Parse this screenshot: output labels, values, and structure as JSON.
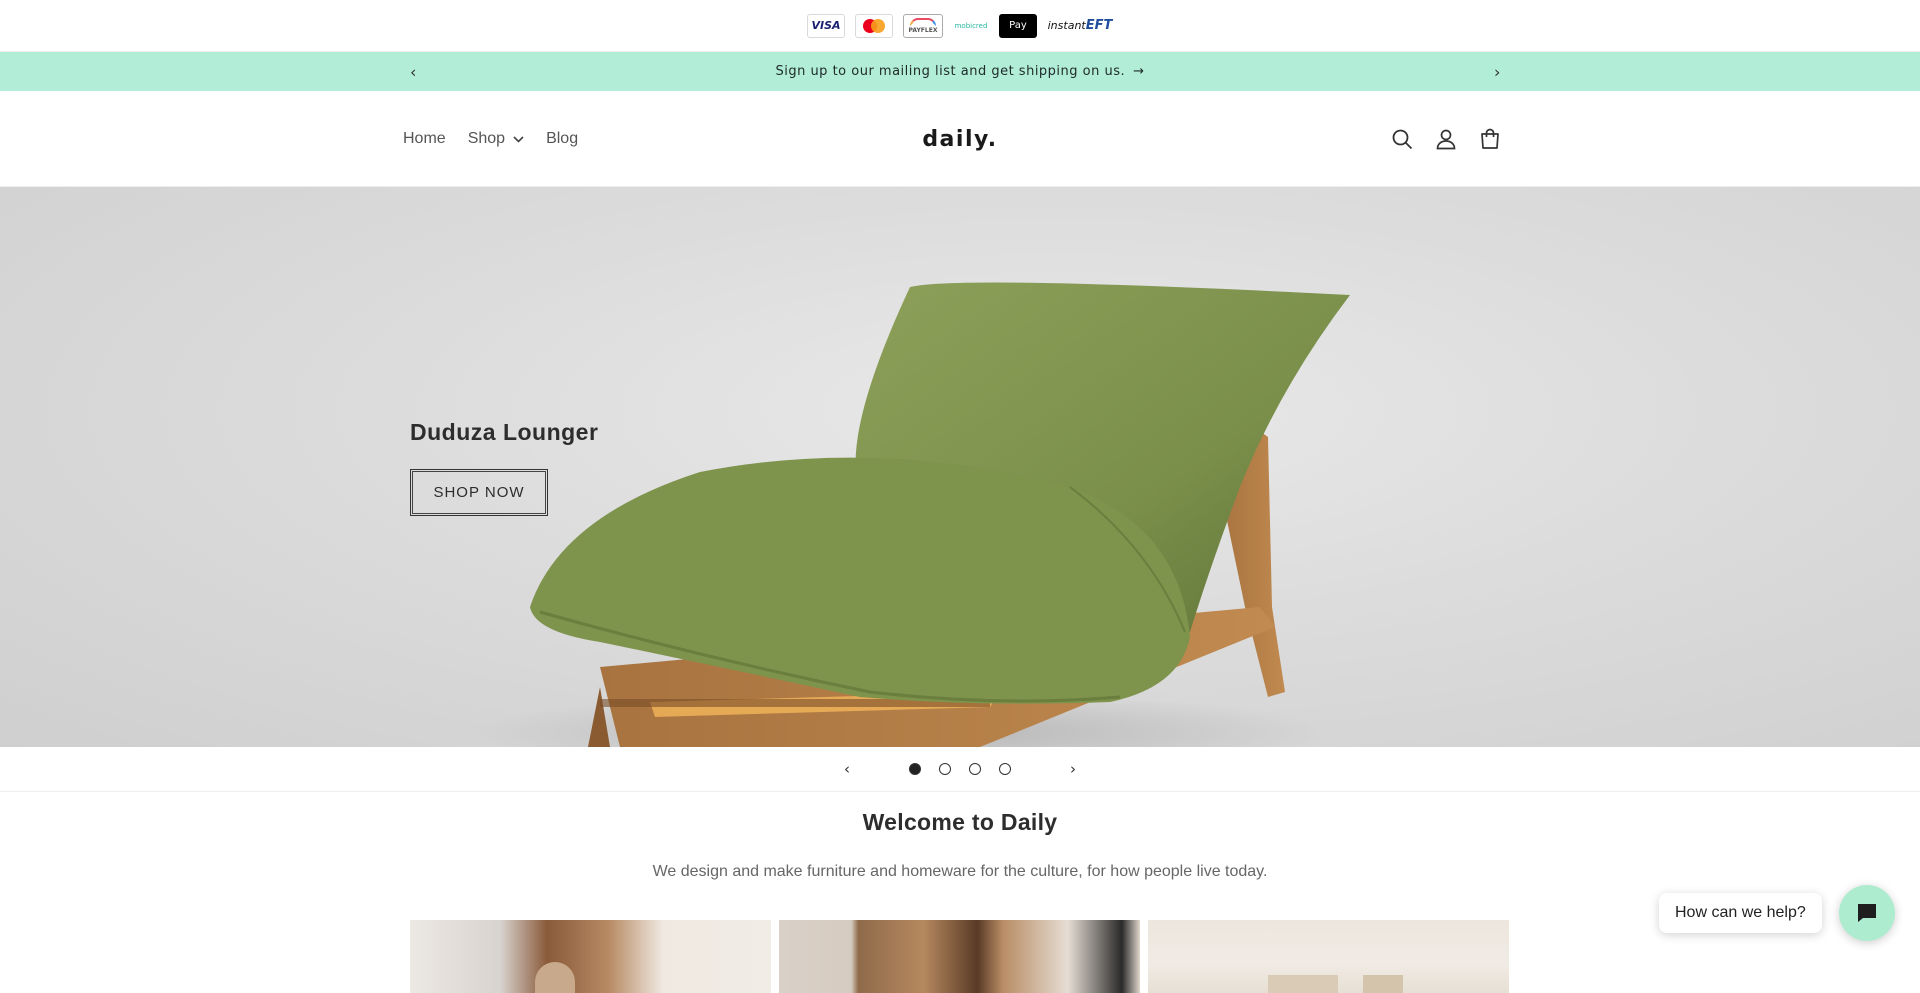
{
  "payment_methods": [
    {
      "name": "Visa",
      "label": "VISA"
    },
    {
      "name": "Mastercard",
      "label": ""
    },
    {
      "name": "Payflex",
      "label": "PAYFLEX"
    },
    {
      "name": "Mobicred",
      "label": "mobicred"
    },
    {
      "name": "Apple Pay",
      "label": "Pay"
    },
    {
      "name": "Instant EFT",
      "label": "instant",
      "label_bold": "EFT"
    }
  ],
  "announcement": {
    "text": "Sign up to our mailing list and get shipping on us.",
    "prev_icon": "chevron-left-icon",
    "next_icon": "chevron-right-icon",
    "arrow_icon": "arrow-right-icon"
  },
  "header": {
    "nav": [
      {
        "label": "Home"
      },
      {
        "label": "Shop",
        "has_dropdown": true
      },
      {
        "label": "Blog"
      }
    ],
    "logo": "daily.",
    "icons": [
      "search-icon",
      "account-icon",
      "cart-icon"
    ]
  },
  "hero": {
    "title": "Duduza Lounger",
    "cta_label": "SHOP NOW"
  },
  "slider": {
    "slide_count": 4,
    "active_index": 0
  },
  "welcome": {
    "title": "Welcome to Daily",
    "subtitle": "We design and make furniture and homeware for the culture, for how people live today."
  },
  "chat": {
    "prompt": "How can we help?",
    "icon": "chat-icon",
    "accent_color": "#aeeccf"
  },
  "colors": {
    "announcement_bg": "#b2eed7",
    "text": "#2a2a2a"
  }
}
